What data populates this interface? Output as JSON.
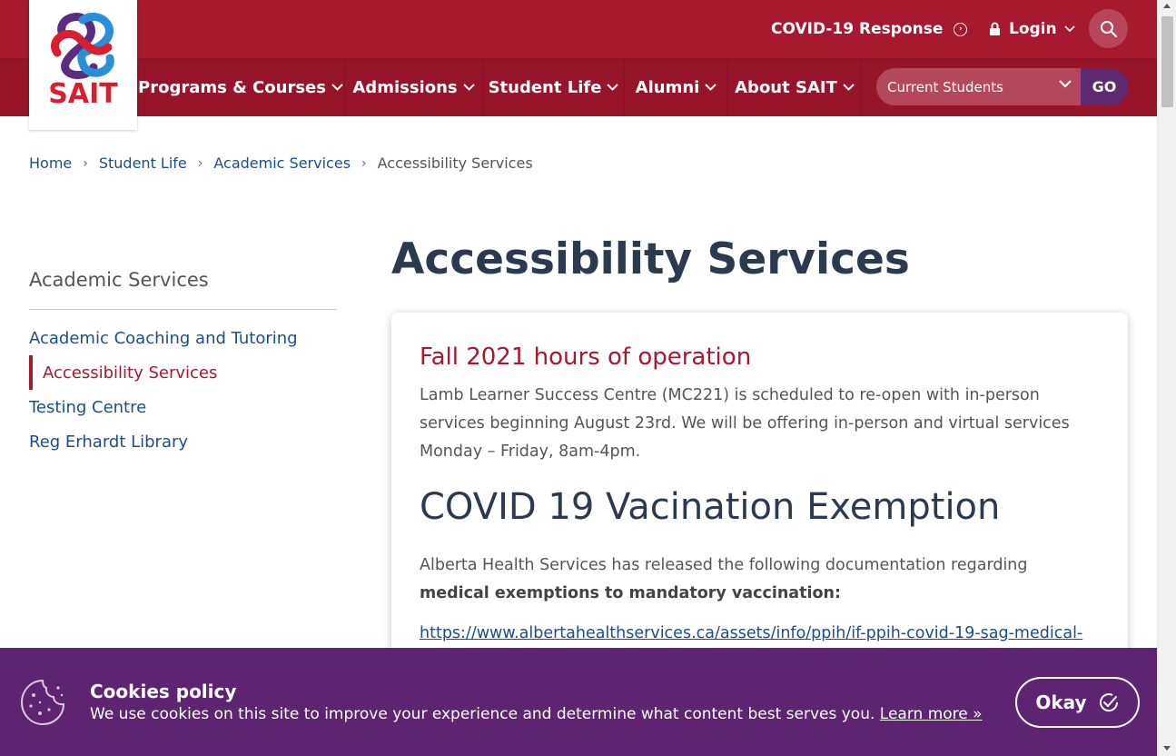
{
  "header": {
    "logo_text": "SAIT",
    "covid_link": "COVID-19 Response",
    "login_label": "Login",
    "nav": [
      {
        "label": "Programs & Courses"
      },
      {
        "label": "Admissions"
      },
      {
        "label": "Student Life"
      },
      {
        "label": "Alumni"
      },
      {
        "label": "About SAIT"
      }
    ],
    "audience_select": "Current Students",
    "go_label": "GO"
  },
  "breadcrumb": [
    {
      "label": "Home"
    },
    {
      "label": "Student Life"
    },
    {
      "label": "Academic Services"
    },
    {
      "label": "Accessibility Services"
    }
  ],
  "sidebar": {
    "title": "Academic Services",
    "items": [
      {
        "label": "Academic Coaching and Tutoring",
        "active": false
      },
      {
        "label": "Accessibility Services",
        "active": true
      },
      {
        "label": "Testing Centre",
        "active": false
      },
      {
        "label": "Reg Erhardt Library",
        "active": false
      }
    ]
  },
  "main": {
    "title": "Accessibility Services",
    "hours_heading": "Fall 2021 hours of operation",
    "hours_text": "Lamb Learner Success Centre (MC221) is scheduled to re-open with in-person services beginning August 23rd. We will be offering in-person and virtual services Monday – Friday, 8am-4pm.",
    "covid_heading": "COVID 19 Vacination Exemption",
    "covid_text_prefix": "Alberta Health Services has released the following documentation regarding ",
    "covid_text_bold": "medical exemptions to mandatory vaccination:",
    "covid_url": "https://www.albertahealthservices.ca/assets/info/ppih/if-ppih-covid-19-sag-medical-"
  },
  "cookie": {
    "title": "Cookies policy",
    "text": "We use cookies on this site to improve your experience and determine what content best serves you. ",
    "learn_more": "Learn more »",
    "okay_label": "Okay"
  },
  "colors": {
    "brand_red": "#a6192e",
    "nav_red": "#97152a",
    "link_blue": "#1c4e8a",
    "title_navy": "#2b3a4f",
    "cookie_purple": "#5e2472",
    "go_purple": "#5e2a72"
  }
}
